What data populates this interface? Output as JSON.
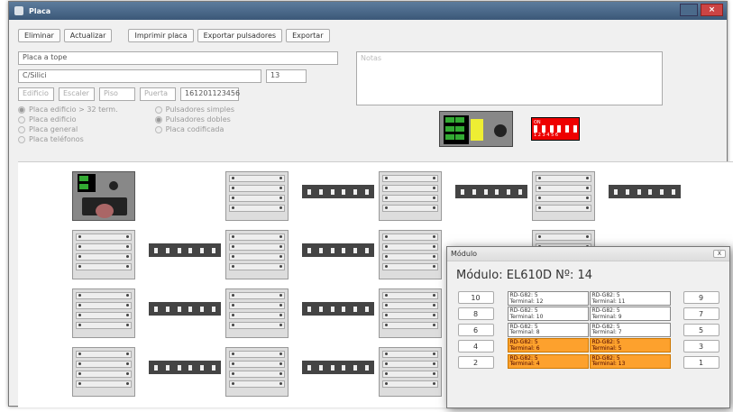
{
  "window": {
    "title": "Placa",
    "close_icon": "close-icon"
  },
  "toolbar": {
    "buttons": [
      {
        "label": "Eliminar"
      },
      {
        "label": "Actualizar"
      },
      {
        "label": "Imprimir placa"
      },
      {
        "label": "Exportar pulsadores"
      },
      {
        "label": "Exportar"
      }
    ]
  },
  "form": {
    "name": "Placa a tope",
    "street": "C/Silici",
    "number": "13",
    "edificio": "Edificio",
    "escalera": "Escaler",
    "piso": "Piso",
    "puerta": "Puerta",
    "id": "161201123456",
    "notes_placeholder": "Notas"
  },
  "radios_left": [
    {
      "label": "Placa edificio > 32 term.",
      "checked": true
    },
    {
      "label": "Placa edificio",
      "checked": false
    },
    {
      "label": "Placa general",
      "checked": false
    },
    {
      "label": "Placa teléfonos",
      "checked": false
    }
  ],
  "radios_right": [
    {
      "label": "Pulsadores simples",
      "checked": false
    },
    {
      "label": "Pulsadores dobles",
      "checked": true
    },
    {
      "label": "Placa codificada",
      "checked": false
    }
  ],
  "hardware": {
    "switch_labels": "1 2 3 4 5 6",
    "on_label": "ON"
  },
  "dialog": {
    "title": "Módulo",
    "header": "Módulo: EL610D Nº: 14",
    "left_btns": [
      "10",
      "8",
      "6",
      "4",
      "2"
    ],
    "right_btns": [
      "9",
      "7",
      "5",
      "3",
      "1"
    ],
    "cells": [
      {
        "text": "RD-G82: 5\nTerminal: 12",
        "color": "white"
      },
      {
        "text": "RD-G82: 5\nTerminal: 11",
        "color": "white"
      },
      {
        "text": "RD-G82: 5\nTerminal: 10",
        "color": "white"
      },
      {
        "text": "RD-G82: 5\nTerminal: 9",
        "color": "white"
      },
      {
        "text": "RD-G82: 5\nTerminal: 8",
        "color": "white"
      },
      {
        "text": "RD-G82: 5\nTerminal: 7",
        "color": "white"
      },
      {
        "text": "RD-G82: 5\nTerminal: 6",
        "color": "orange"
      },
      {
        "text": "RD-G82: 5\nTerminal: 5",
        "color": "orange"
      },
      {
        "text": "RD-G82: 5\nTerminal: 4",
        "color": "orange"
      },
      {
        "text": "RD-G82: 5\nTerminal: 13",
        "color": "orange"
      }
    ]
  }
}
